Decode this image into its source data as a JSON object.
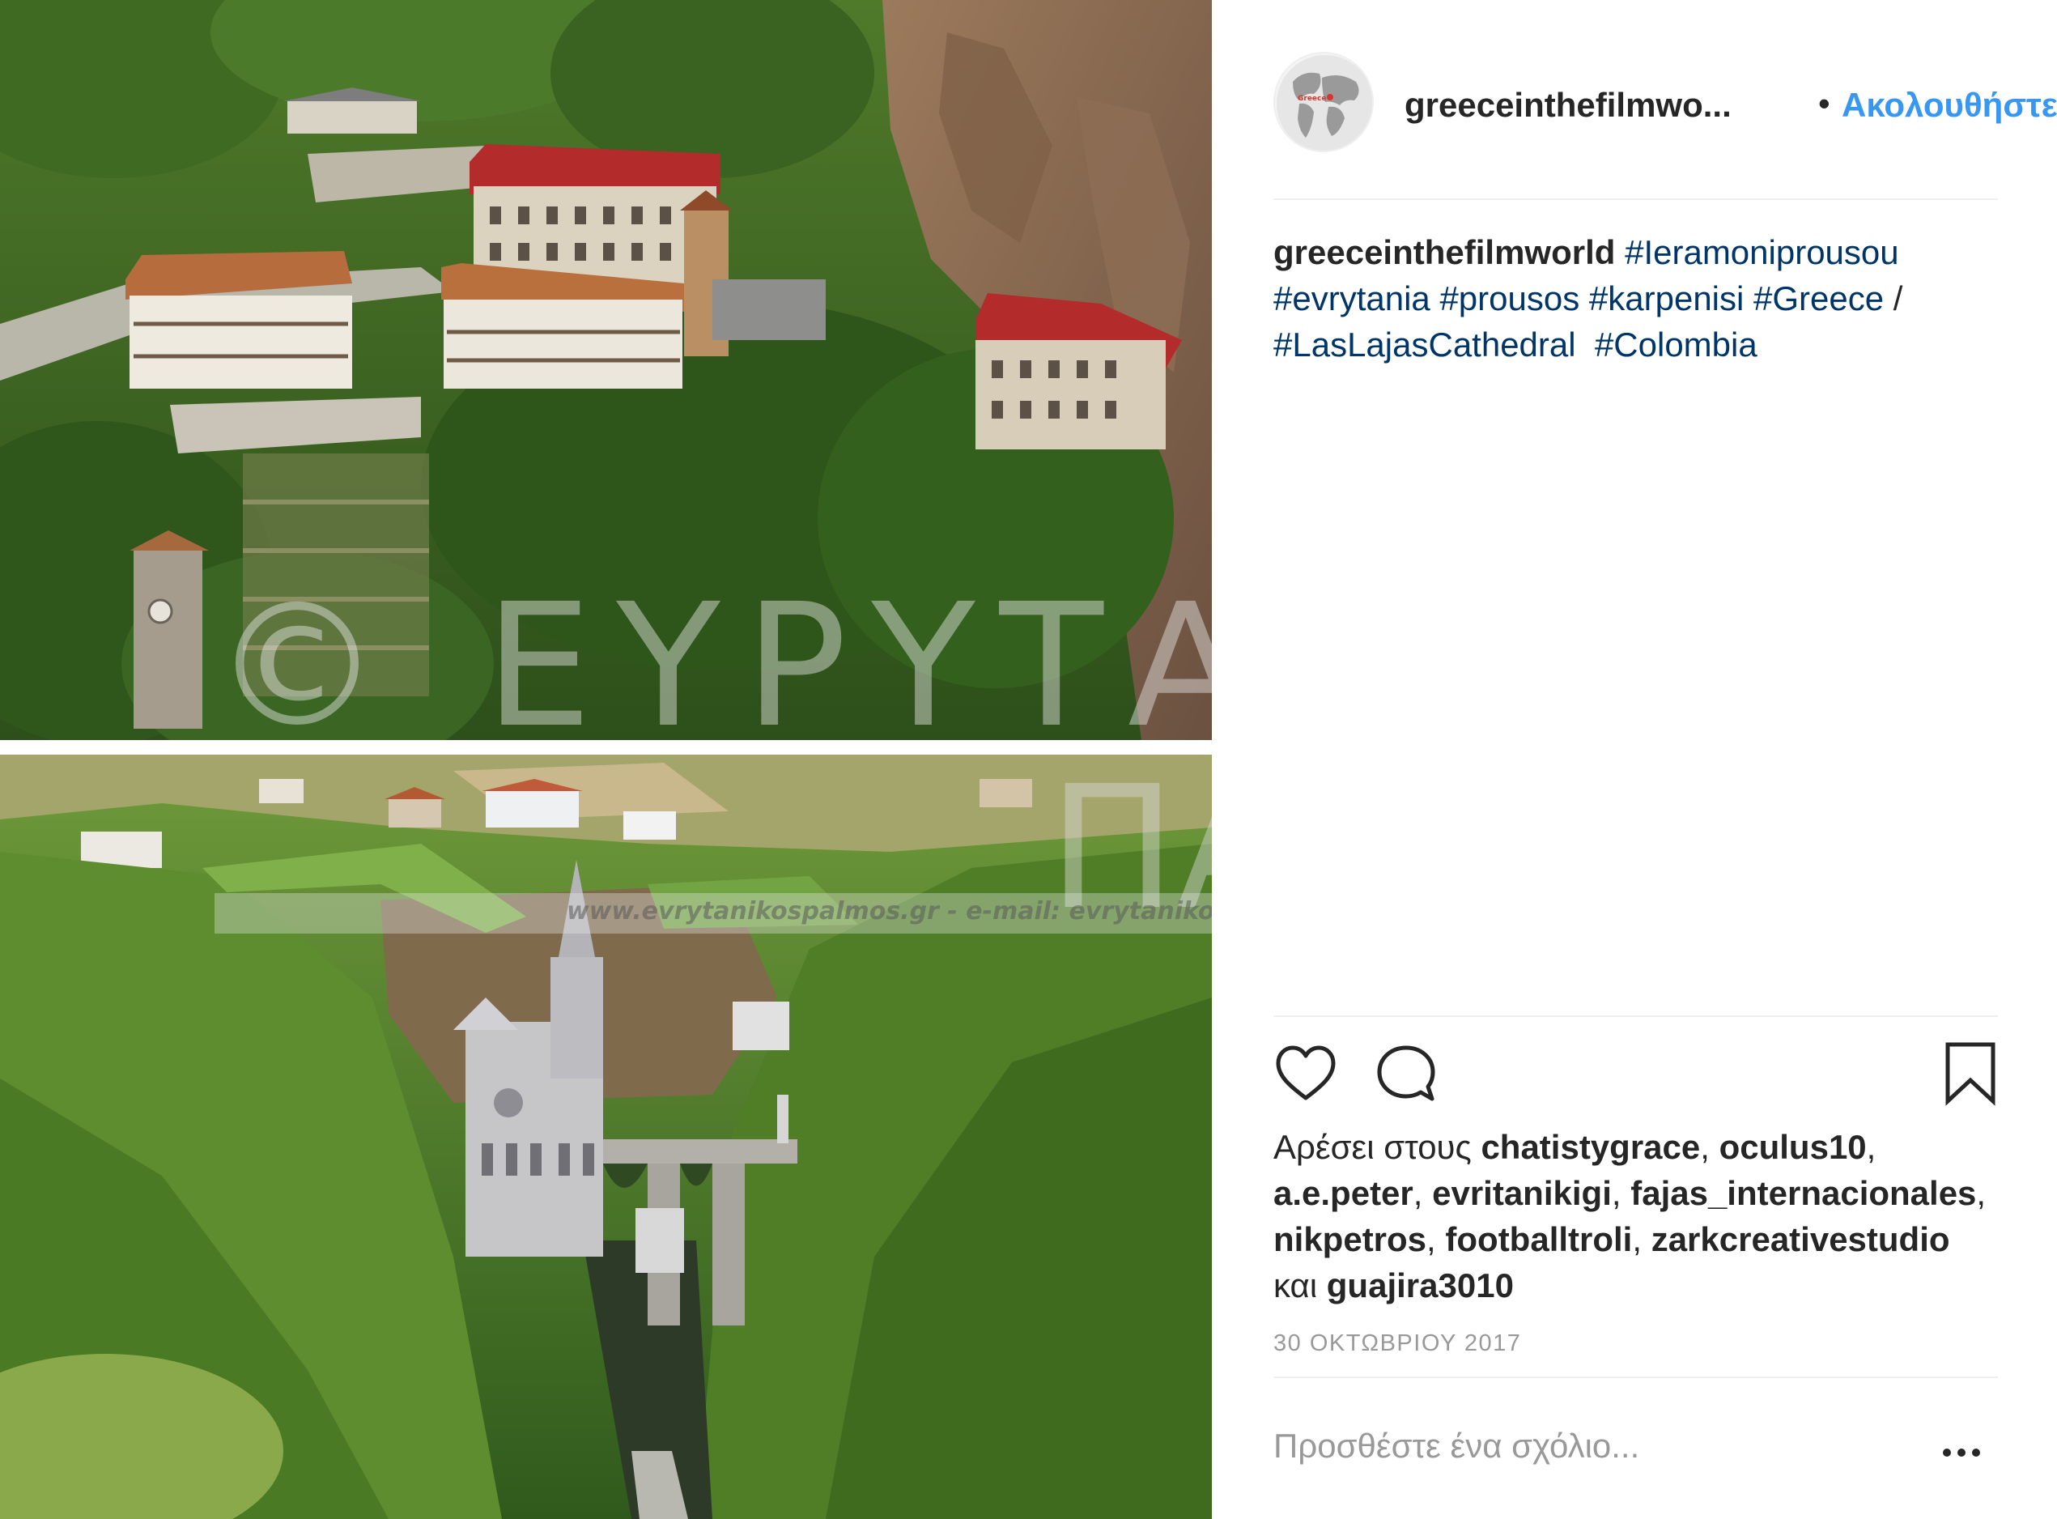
{
  "post": {
    "username_short": "greeceinthefilmwo...",
    "dot": "•",
    "follow_label": "Ακολουθήστε",
    "avatar_label": "Greece",
    "caption": {
      "author": "greeceinthefilmworld",
      "tags_line1": [
        "#Ieramoniprousou"
      ],
      "tags_line2": [
        "#evrytania",
        "#prousos",
        "#karpenisi",
        "#Greece"
      ],
      "slash": "/",
      "tags_line3": [
        "#LasLajasCathedral",
        "#Colombia"
      ]
    },
    "likes": {
      "prefix": "Αρέσει στους",
      "users": [
        "chatistygrace",
        "oculus10",
        "a.e.peter",
        "evritanikigi",
        "fajas_internacionales",
        "nikpetros",
        "footballtroli",
        "zarkcreativestudio"
      ],
      "and_word": "και",
      "last_user": "guajira3010"
    },
    "date": "30 ΟΚΤΩΒΡΙΟΥ 2017",
    "comment_placeholder": "Προσθέστε ένα σχόλιο...",
    "more_label": "..."
  },
  "media": {
    "watermark_text": "© ΕΥΡΥΤΑΝ",
    "watermark_text2": "ΠΑ",
    "watermark_url": "www.evrytanikospalmos.gr - e-mail: evrytanikos"
  },
  "icons": {
    "like": "heart-icon",
    "comment": "comment-icon",
    "save": "bookmark-icon",
    "more": "more-options-icon"
  },
  "colors": {
    "link_blue": "#3897f0",
    "hashtag": "#003569",
    "text": "#262626",
    "muted": "#999999",
    "divider": "#efefef"
  }
}
